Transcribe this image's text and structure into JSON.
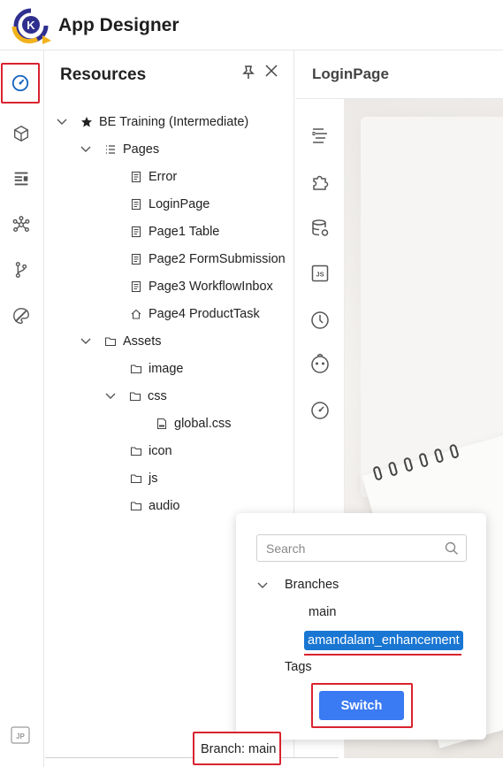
{
  "app": {
    "title": "App Designer"
  },
  "resources": {
    "title": "Resources",
    "tree": [
      {
        "label": "BE Training (Intermediate)",
        "icon": "star-icon",
        "expanded": true
      },
      {
        "label": "Pages",
        "icon": "list-icon",
        "expanded": true
      },
      {
        "label": "Error",
        "icon": "page-icon"
      },
      {
        "label": "LoginPage",
        "icon": "page-icon"
      },
      {
        "label": "Page1 Table",
        "icon": "page-icon"
      },
      {
        "label": "Page2 FormSubmission",
        "icon": "page-icon"
      },
      {
        "label": "Page3 WorkflowInbox",
        "icon": "page-icon"
      },
      {
        "label": "Page4 ProductTask",
        "icon": "home-icon"
      },
      {
        "label": "Assets",
        "icon": "folder-icon",
        "expanded": true
      },
      {
        "label": "image",
        "icon": "folder-icon"
      },
      {
        "label": "css",
        "icon": "folder-icon",
        "expanded": true
      },
      {
        "label": "global.css",
        "icon": "css-file-icon"
      },
      {
        "label": "icon",
        "icon": "folder-icon"
      },
      {
        "label": "js",
        "icon": "folder-icon"
      },
      {
        "label": "audio",
        "icon": "folder-icon"
      }
    ]
  },
  "editor": {
    "title": "LoginPage"
  },
  "branch_popup": {
    "search_placeholder": "Search",
    "branches_label": "Branches",
    "branches": [
      "main",
      "amandalam_enhancement"
    ],
    "selected_branch": "amandalam_enhancement",
    "tags_label": "Tags",
    "switch_label": "Switch"
  },
  "status": {
    "branch": "Branch: main"
  },
  "colors": {
    "accent": "#3a7af2",
    "selection": "#1976d2",
    "highlight": "#d9232f"
  }
}
